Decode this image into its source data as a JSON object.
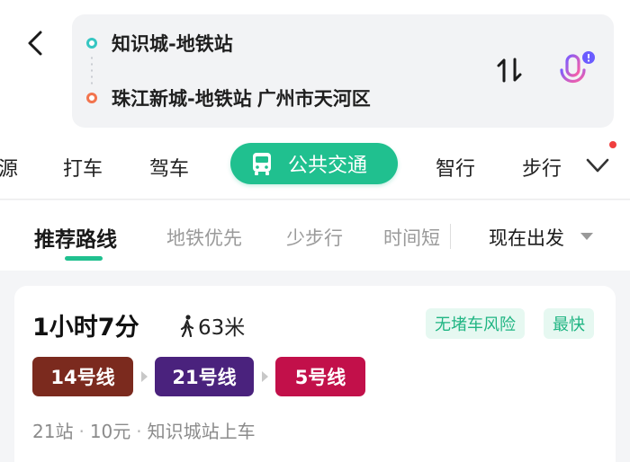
{
  "search": {
    "origin": "知识城-地铁站",
    "destination": "珠江新城-地铁站",
    "destination_city": "广州市天河区"
  },
  "icons": {
    "back": "back-arrow-icon",
    "swap": "swap-icon",
    "voice": "microphone-icon",
    "transit": "bus-icon",
    "walk": "walk-icon",
    "more": "chevron-down-icon"
  },
  "modes": {
    "items": [
      "源",
      "打车",
      "驾车",
      "公共交通",
      "智行",
      "步行"
    ],
    "active_color": "#20c08f"
  },
  "subtabs": {
    "items": [
      "推荐路线",
      "地铁优先",
      "少步行",
      "时间短"
    ],
    "depart_label": "现在出发"
  },
  "route": {
    "duration": "1小时7分",
    "walk_distance": "63米",
    "tags": [
      "无堵车风险",
      "最快"
    ],
    "lines": [
      {
        "label": "14号线",
        "color": "#7b2a1e"
      },
      {
        "label": "21号线",
        "color": "#4a227d"
      },
      {
        "label": "5号线",
        "color": "#c2104a"
      }
    ],
    "meta": {
      "stations": "21站",
      "fare": "10元",
      "boarding": "知识城站上车"
    }
  }
}
